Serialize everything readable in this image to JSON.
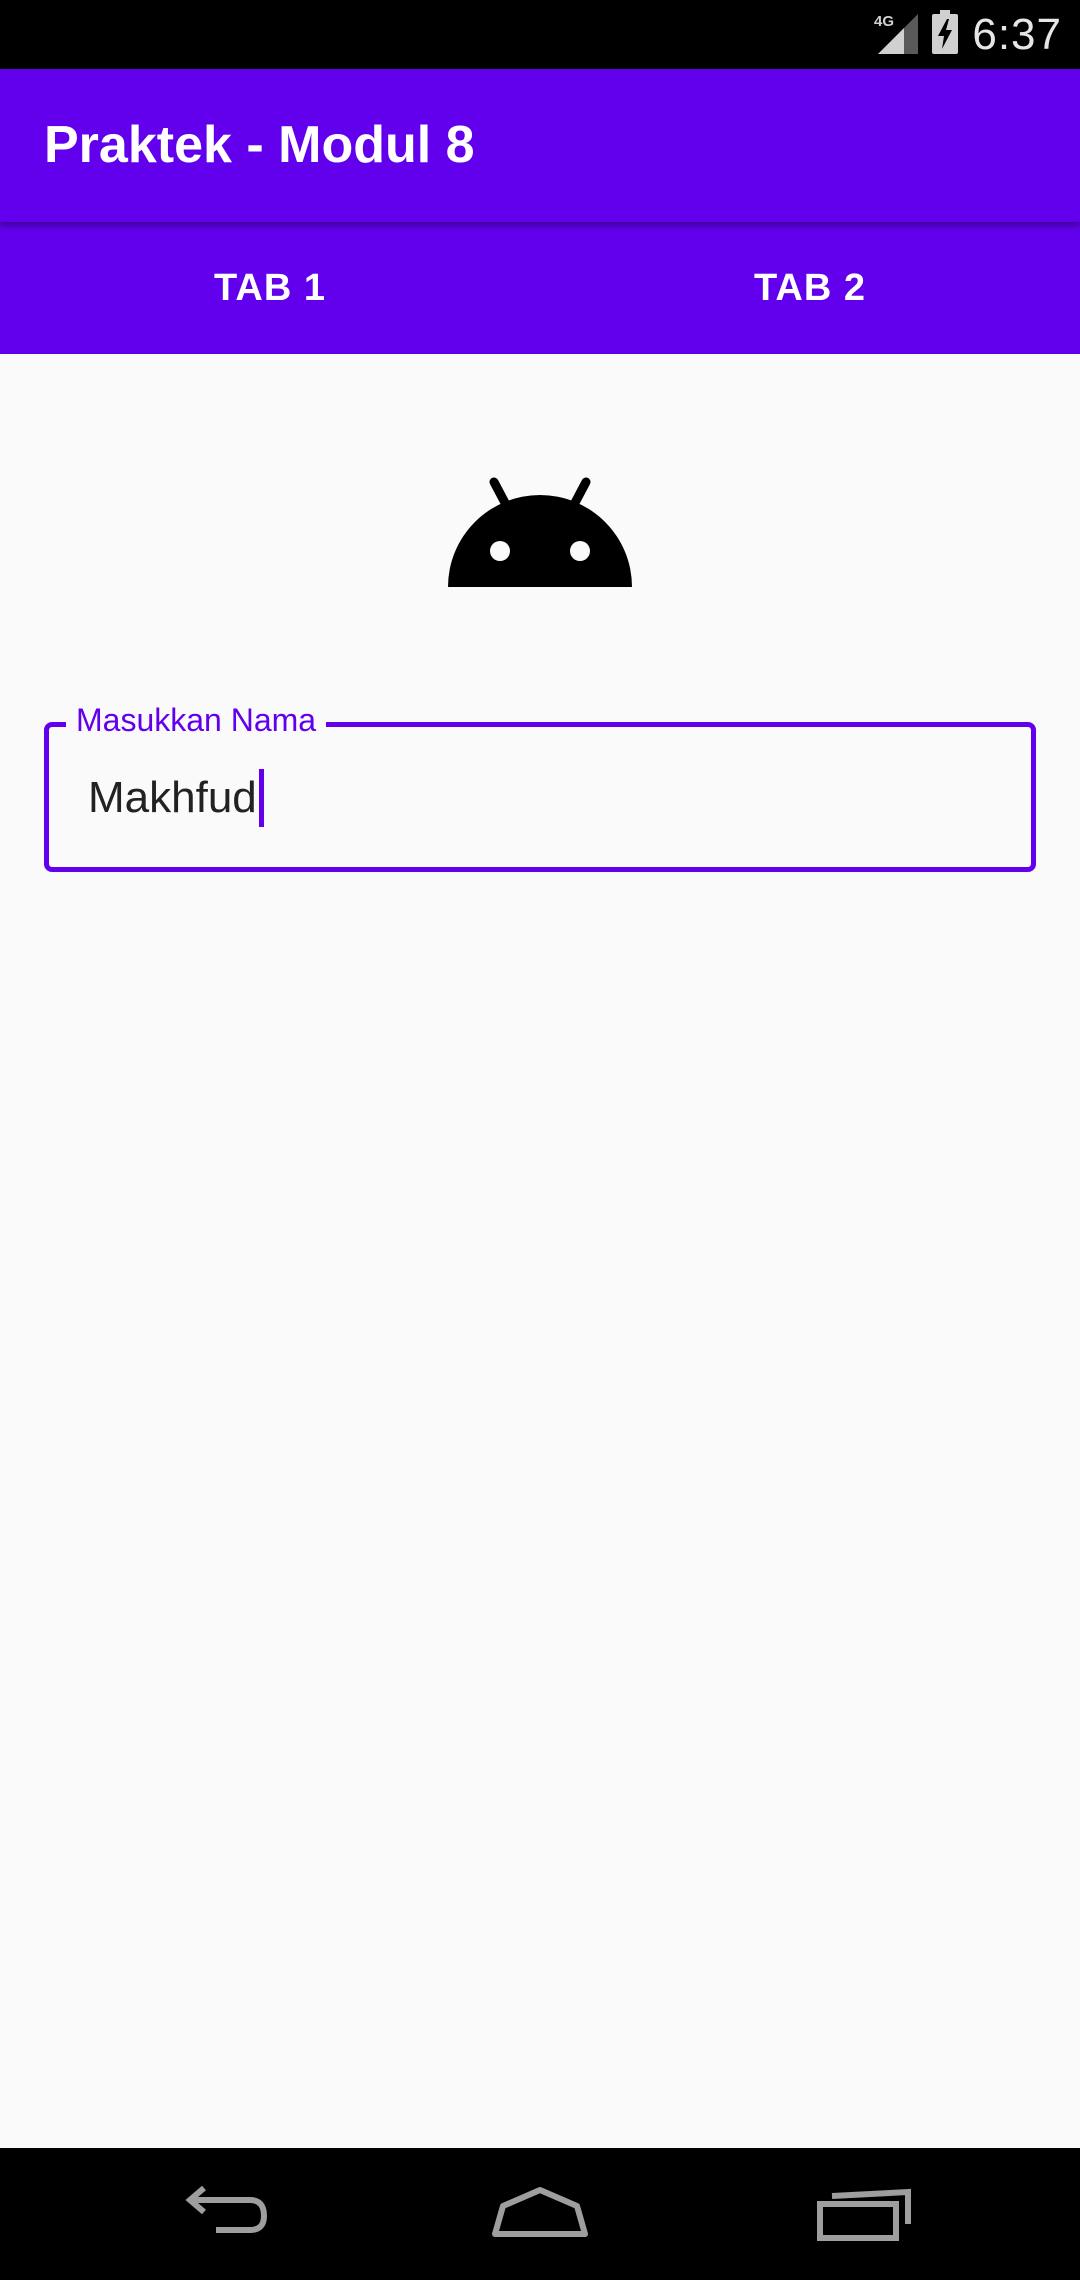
{
  "status_bar": {
    "network": "4G",
    "time": "6:37",
    "icons": [
      "signal-icon",
      "battery-charging-icon"
    ]
  },
  "app_bar": {
    "title": "Praktek - Modul 8"
  },
  "tabs": [
    {
      "label": "TAB 1"
    },
    {
      "label": "TAB 2"
    }
  ],
  "content": {
    "logo_icon": "android-icon",
    "name_field": {
      "label": "Masukkan Nama",
      "value": "Makhfud"
    }
  },
  "nav_bar": {
    "icons": [
      "back-icon",
      "home-icon",
      "recents-icon"
    ]
  },
  "colors": {
    "primary": "#6200ee",
    "status_bar": "#000000",
    "background": "#fafafa"
  }
}
